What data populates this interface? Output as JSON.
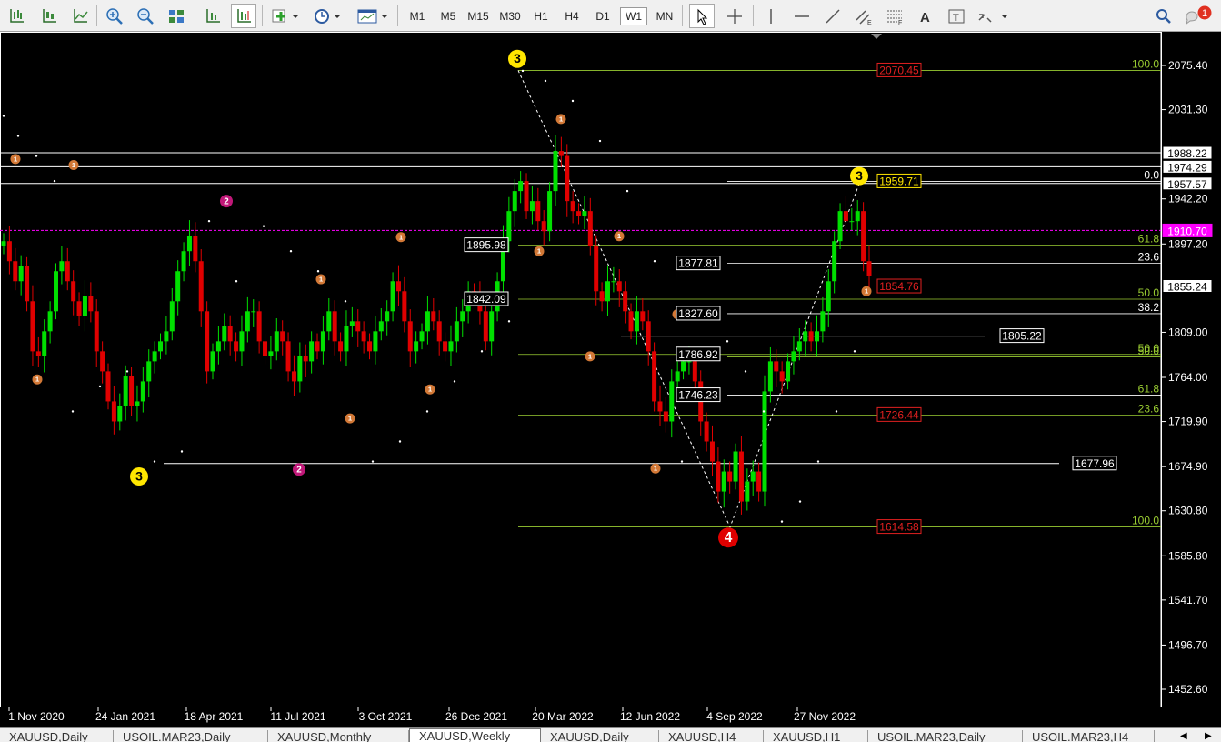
{
  "toolbar": {
    "timeframes": [
      "M1",
      "M5",
      "M15",
      "M30",
      "H1",
      "H4",
      "D1",
      "W1",
      "MN"
    ],
    "active_timeframe": "W1",
    "notification_count": "1"
  },
  "chart": {
    "symbol": "XAUUSD",
    "period": "W1",
    "y_axis_ticks": [
      "2075.40",
      "2031.30",
      "1942.20",
      "1897.20",
      "1855.24",
      "1809.00",
      "1764.00",
      "1719.90",
      "1674.90",
      "1630.80",
      "1585.80",
      "1541.70",
      "1496.70",
      "1452.60"
    ],
    "x_axis_ticks": [
      "1 Nov 2020",
      "24 Jan 2021",
      "18 Apr 2021",
      "11 Jul 2021",
      "3 Oct 2021",
      "26 Dec 2021",
      "20 Mar 2022",
      "12 Jun 2022",
      "4 Sep 2022",
      "27 Nov 2022"
    ],
    "axis_price_boxes": [
      {
        "text": "1988.22",
        "style": "white"
      },
      {
        "text": "1974.29",
        "style": "white"
      },
      {
        "text": "1957.57",
        "style": "white"
      },
      {
        "text": "1910.70",
        "style": "magenta"
      },
      {
        "text": "1855.24",
        "style": "white"
      }
    ],
    "in_chart_labels": [
      {
        "text": "2070.45",
        "style": "red"
      },
      {
        "text": "1959.71",
        "style": "yellow"
      },
      {
        "text": "1895.98",
        "style": "white"
      },
      {
        "text": "1877.81",
        "style": "white"
      },
      {
        "text": "1854.76",
        "style": "red"
      },
      {
        "text": "1842.09",
        "style": "white"
      },
      {
        "text": "1827.60",
        "style": "white"
      },
      {
        "text": "1805.22",
        "style": "white"
      },
      {
        "text": "1786.92",
        "style": "white"
      },
      {
        "text": "1746.23",
        "style": "white"
      },
      {
        "text": "1726.44",
        "style": "red"
      },
      {
        "text": "1677.96",
        "style": "white"
      },
      {
        "text": "1614.58",
        "style": "red"
      }
    ],
    "fib_levels": [
      "100.0",
      "0.0",
      "61.8",
      "23.6",
      "50.0",
      "38.2",
      "50.0",
      "50.0",
      "61.8",
      "23.6",
      "100.0"
    ],
    "wave_markers": [
      "3",
      "3",
      "3",
      "4",
      "2",
      "2",
      "1",
      "1",
      "1",
      "1",
      "1",
      "1",
      "1",
      "1",
      "1",
      "1",
      "1",
      "1"
    ],
    "colors": {
      "bull": "#00e000",
      "bear": "#e00000",
      "fib": "#9acd32",
      "psar": "#ffffff"
    }
  },
  "tabs": [
    "XAUUSD,Daily",
    "USOIL.MAR23,Daily",
    "XAUUSD,Monthly",
    "XAUUSD,Weekly",
    "XAUUSD,Daily",
    "XAUUSD,H4",
    "XAUUSD,H1",
    "USOIL.MAR23,Daily",
    "USOIL.MAR23,H4"
  ],
  "active_tab": "XAUUSD,Weekly"
}
